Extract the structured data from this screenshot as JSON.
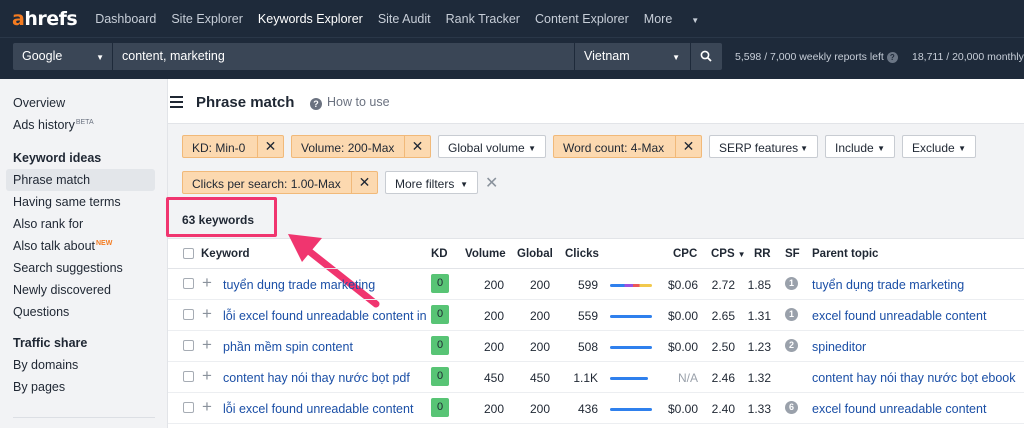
{
  "app": {
    "logo_a": "a",
    "logo_rest": "hrefs"
  },
  "nav": {
    "items": [
      "Dashboard",
      "Site Explorer",
      "Keywords Explorer",
      "Site Audit",
      "Rank Tracker",
      "Content Explorer",
      "More"
    ],
    "active": "Keywords Explorer"
  },
  "search": {
    "engine": "Google",
    "query": "content, marketing",
    "country": "Vietnam",
    "quota_weekly": "5,598 / 7,000 weekly reports left",
    "quota_monthly": "18,711 / 20,000 monthly"
  },
  "sidebar": {
    "overview": "Overview",
    "ads_history": "Ads history",
    "ads_badge": "BETA",
    "keyword_ideas": "Keyword ideas",
    "phrase_match": "Phrase match",
    "same_terms": "Having same terms",
    "also_rank": "Also rank for",
    "also_talk": "Also talk about",
    "also_talk_badge": "NEW",
    "suggestions": "Search suggestions",
    "newly": "Newly discovered",
    "questions": "Questions",
    "traffic_share": "Traffic share",
    "by_domains": "By domains",
    "by_pages": "By pages"
  },
  "page": {
    "title": "Phrase match",
    "how_to": "How to use"
  },
  "filters": {
    "kd": "KD: Min-0",
    "volume": "Volume: 200-Max",
    "global_volume": "Global volume",
    "word_count": "Word count: 4-Max",
    "serp_features": "SERP features",
    "include": "Include",
    "exclude": "Exclude",
    "cps": "Clicks per search: 1.00-Max",
    "more_filters": "More filters"
  },
  "results": {
    "count": "63 keywords"
  },
  "table": {
    "headers": {
      "keyword": "Keyword",
      "kd": "KD",
      "volume": "Volume",
      "global": "Global",
      "clicks": "Clicks",
      "cpc": "CPC",
      "cps": "CPS",
      "rr": "RR",
      "sf": "SF",
      "parent": "Parent topic"
    },
    "rows": [
      {
        "keyword": "tuyển dụng trade marketing",
        "kd": "0",
        "volume": "200",
        "global": "200",
        "clicks": "599",
        "cpc": "$0.06",
        "cps": "2.72",
        "rr": "1.85",
        "sf": "1",
        "parent": "tuyển dụng trade marketing",
        "bar": "multi"
      },
      {
        "keyword": "lỗi excel found unreadable content in",
        "kd": "0",
        "volume": "200",
        "global": "200",
        "clicks": "559",
        "cpc": "$0.00",
        "cps": "2.65",
        "rr": "1.31",
        "sf": "1",
        "parent": "excel found unreadable content",
        "bar": "blue"
      },
      {
        "keyword": "phần mềm spin content",
        "kd": "0",
        "volume": "200",
        "global": "200",
        "clicks": "508",
        "cpc": "$0.00",
        "cps": "2.50",
        "rr": "1.23",
        "sf": "2",
        "parent": "spineditor",
        "bar": "blue"
      },
      {
        "keyword": "content hay nói thay nước bọt pdf",
        "kd": "0",
        "volume": "450",
        "global": "450",
        "clicks": "1.1K",
        "cpc": "N/A",
        "cps": "2.46",
        "rr": "1.32",
        "sf": "",
        "parent": "content hay nói thay nước bọt ebook",
        "bar": "blue-short"
      },
      {
        "keyword": "lỗi excel found unreadable content",
        "kd": "0",
        "volume": "200",
        "global": "200",
        "clicks": "436",
        "cpc": "$0.00",
        "cps": "2.40",
        "rr": "1.33",
        "sf": "6",
        "parent": "excel found unreadable content",
        "bar": "blue"
      }
    ]
  },
  "colors": {
    "accent": "#f47b20",
    "nav_bg": "#1e2a3a",
    "highlight": "#f0356f",
    "kd_green": "#58c475",
    "link": "#1b4fa6"
  }
}
